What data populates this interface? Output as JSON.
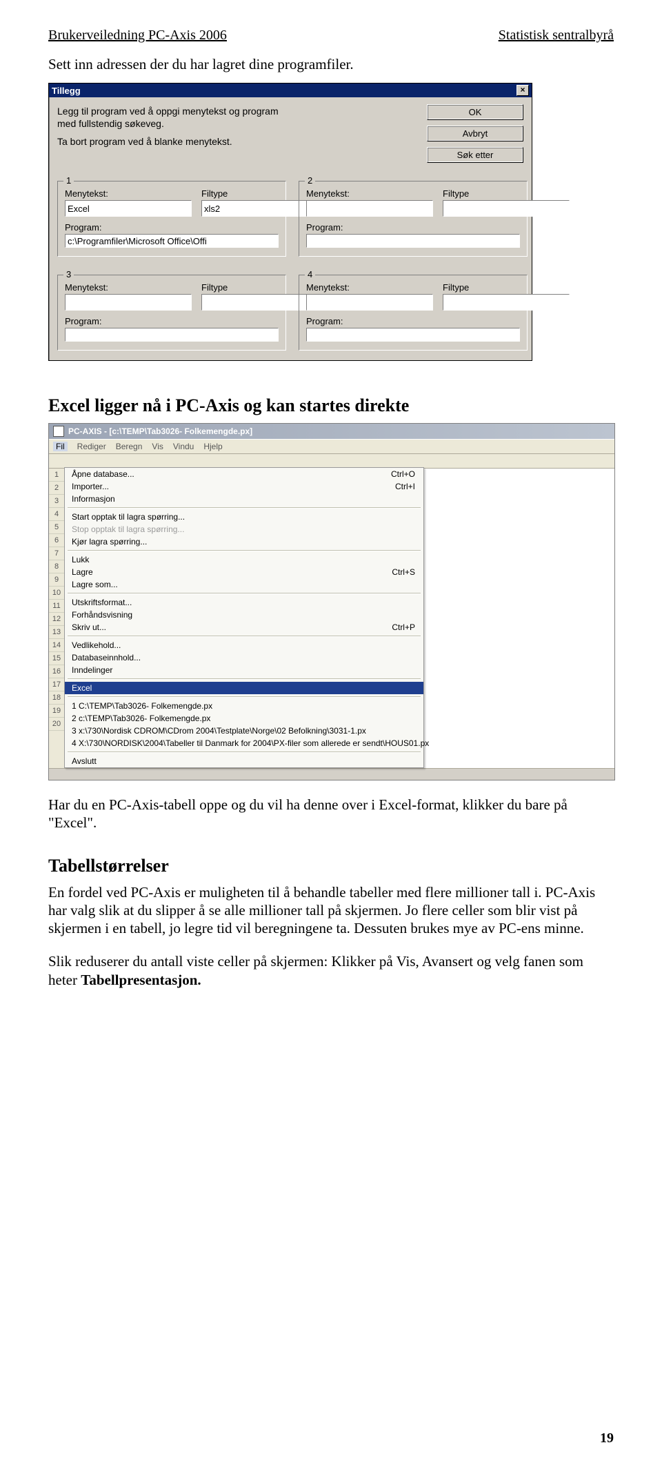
{
  "header": {
    "left": "Brukerveiledning PC-Axis 2006",
    "right": "Statistisk sentralbyrå"
  },
  "intro_line": "Sett inn adressen der du har lagret dine programfiler.",
  "dialog": {
    "title": "Tillegg",
    "close": "×",
    "desc1": "Legg til program ved å oppgi menytekst og program",
    "desc2": "med fullstendig søkeveg.",
    "desc3": "Ta bort program ved å blanke menytekst.",
    "buttons": {
      "ok": "OK",
      "cancel": "Avbryt",
      "browse": "Søk etter"
    },
    "labels": {
      "menutext": "Menytekst:",
      "filetype": "Filtype",
      "program": "Program:"
    },
    "groups": {
      "g1": {
        "num": "1",
        "menutext": "Excel",
        "filetype": "xls2",
        "program": "c:\\Programfiler\\Microsoft Office\\Offi"
      },
      "g2": {
        "num": "2",
        "menutext": "",
        "filetype": "",
        "program": ""
      },
      "g3": {
        "num": "3",
        "menutext": "",
        "filetype": "",
        "program": ""
      },
      "g4": {
        "num": "4",
        "menutext": "",
        "filetype": "",
        "program": ""
      }
    }
  },
  "mid_heading": "Excel ligger nå i PC-Axis og kan startes direkte",
  "pcaxis": {
    "title": "PC-AXIS - [c:\\TEMP\\Tab3026- Folkemengde.px]",
    "menus": [
      "Fil",
      "Rediger",
      "Beregn",
      "Vis",
      "Vindu",
      "Hjelp"
    ],
    "rows": [
      "1",
      "2",
      "3",
      "4",
      "5",
      "6",
      "7",
      "8",
      "9",
      "10",
      "11",
      "12",
      "13",
      "14",
      "15",
      "16",
      "17",
      "18",
      "19",
      "20"
    ],
    "items": [
      {
        "t": "item",
        "label": "Åpne database...",
        "sc": "Ctrl+O"
      },
      {
        "t": "item",
        "label": "Importer...",
        "sc": "Ctrl+I"
      },
      {
        "t": "item",
        "label": "Informasjon",
        "sc": ""
      },
      {
        "t": "sep"
      },
      {
        "t": "item",
        "label": "Start opptak til lagra spørring...",
        "sc": ""
      },
      {
        "t": "item",
        "label": "Stop opptak til lagra spørring...",
        "sc": "",
        "disabled": true
      },
      {
        "t": "item",
        "label": "Kjør lagra spørring...",
        "sc": ""
      },
      {
        "t": "sep"
      },
      {
        "t": "item",
        "label": "Lukk",
        "sc": ""
      },
      {
        "t": "item",
        "label": "Lagre",
        "sc": "Ctrl+S"
      },
      {
        "t": "item",
        "label": "Lagre som...",
        "sc": ""
      },
      {
        "t": "sep"
      },
      {
        "t": "item",
        "label": "Utskriftsformat...",
        "sc": ""
      },
      {
        "t": "item",
        "label": "Forhåndsvisning",
        "sc": ""
      },
      {
        "t": "item",
        "label": "Skriv ut...",
        "sc": "Ctrl+P"
      },
      {
        "t": "sep"
      },
      {
        "t": "item",
        "label": "Vedlikehold...",
        "sc": ""
      },
      {
        "t": "item",
        "label": "Databaseinnhold...",
        "sc": ""
      },
      {
        "t": "item",
        "label": "Inndelinger",
        "sc": ""
      },
      {
        "t": "sep"
      },
      {
        "t": "item",
        "label": "Excel",
        "sc": "",
        "highlight": true
      },
      {
        "t": "sep"
      },
      {
        "t": "item",
        "label": "1 C:\\TEMP\\Tab3026- Folkemengde.px",
        "sc": ""
      },
      {
        "t": "item",
        "label": "2 c:\\TEMP\\Tab3026- Folkemengde.px",
        "sc": ""
      },
      {
        "t": "item",
        "label": "3 x:\\730\\Nordisk CDROM\\CDrom 2004\\Testplate\\Norge\\02 Befolkning\\3031-1.px",
        "sc": ""
      },
      {
        "t": "item",
        "label": "4 X:\\730\\NORDISK\\2004\\Tabeller til Danmark for 2004\\PX-filer som allerede er sendt\\HOUS01.px",
        "sc": ""
      },
      {
        "t": "sep"
      },
      {
        "t": "item",
        "label": "Avslutt",
        "sc": ""
      }
    ]
  },
  "after_menu_para": "Har du en PC-Axis-tabell oppe og du vil ha denne over i Excel-format, klikker du bare på \"Excel\".",
  "section_heading": "Tabellstørrelser",
  "section_para": "En fordel ved PC-Axis er muligheten til å behandle tabeller med flere millioner tall i. PC-Axis har valg slik at du slipper å se alle millioner tall på skjermen. Jo flere celler som blir vist på skjermen i en tabell, jo legre tid vil beregningene ta. Dessuten brukes mye av PC-ens minne.",
  "section_para2_pre": "Slik reduserer du antall viste celler på skjermen: Klikker på Vis, Avansert og velg fanen som heter ",
  "section_para2_bold": "Tabellpresentasjon.",
  "page_number": "19"
}
